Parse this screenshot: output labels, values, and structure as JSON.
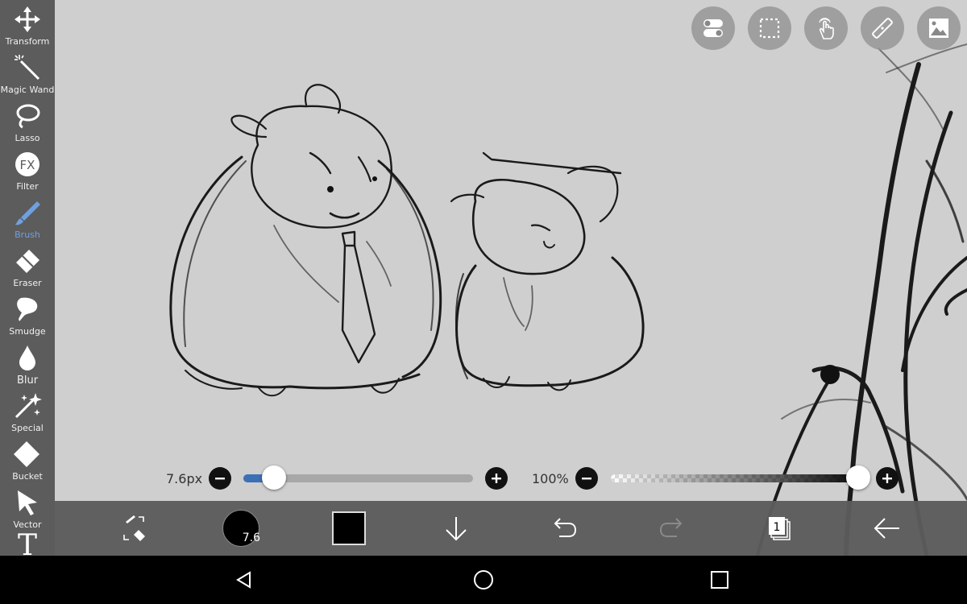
{
  "toolbar": {
    "tools": [
      {
        "id": "transform",
        "label": "Transform",
        "icon": "move-arrows-icon"
      },
      {
        "id": "magic-wand",
        "label": "Magic Wand",
        "icon": "magic-wand-icon"
      },
      {
        "id": "lasso",
        "label": "Lasso",
        "icon": "lasso-icon"
      },
      {
        "id": "filter",
        "label": "Filter",
        "icon": "fx-icon"
      },
      {
        "id": "brush",
        "label": "Brush",
        "icon": "brush-icon",
        "active": true
      },
      {
        "id": "eraser",
        "label": "Eraser",
        "icon": "eraser-icon"
      },
      {
        "id": "smudge",
        "label": "Smudge",
        "icon": "smudge-icon"
      },
      {
        "id": "blur",
        "label": "Blur",
        "icon": "droplet-icon"
      },
      {
        "id": "special",
        "label": "Special",
        "icon": "sparkle-icon"
      },
      {
        "id": "bucket",
        "label": "Bucket",
        "icon": "bucket-icon"
      },
      {
        "id": "vector",
        "label": "Vector",
        "icon": "cursor-arrow-icon"
      },
      {
        "id": "text",
        "label": "T",
        "icon": "text-icon"
      }
    ],
    "fx_text": "FX",
    "accent_color": "#6fa0e0"
  },
  "top_buttons": [
    {
      "id": "toggle",
      "icon": "toggle-switch-icon"
    },
    {
      "id": "selection",
      "icon": "selection-rect-icon"
    },
    {
      "id": "touch",
      "icon": "hand-touch-icon"
    },
    {
      "id": "ruler",
      "icon": "ruler-icon"
    },
    {
      "id": "image",
      "icon": "image-icon"
    }
  ],
  "sliders": {
    "brush_size": {
      "label": "7.6px",
      "value": 7.6,
      "fraction": 0.14
    },
    "opacity": {
      "label": "100%",
      "value": 100,
      "fraction": 1.0
    }
  },
  "actionbar": {
    "brush_size_badge": "7.6",
    "color": "#000000",
    "layer_count": "1"
  },
  "navbar": {
    "buttons": [
      "back-icon",
      "home-icon",
      "recents-icon"
    ]
  },
  "colors": {
    "canvas_bg": "#cfcfcf",
    "toolbar_bg": "#5c5c5c",
    "slider_accent": "#3d6fb6"
  }
}
